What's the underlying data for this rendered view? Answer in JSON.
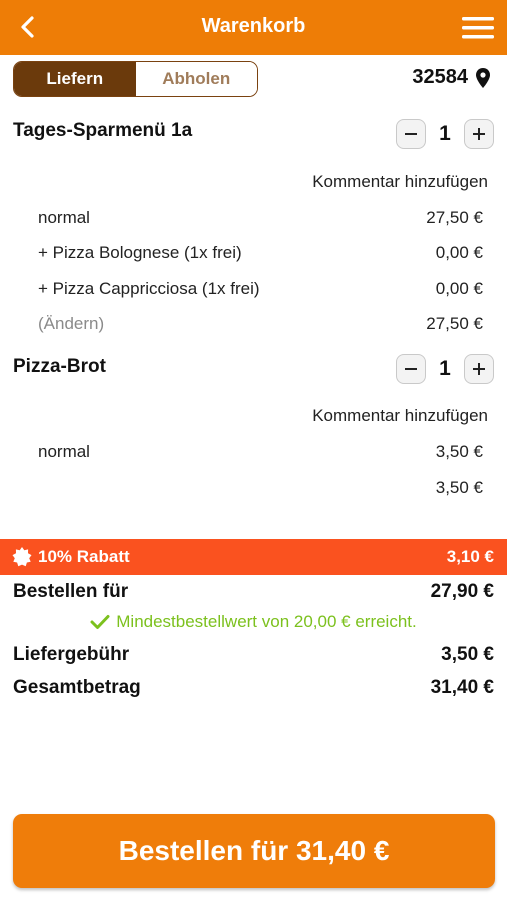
{
  "header": {
    "title": "Warenkorb"
  },
  "mode": {
    "deliver_label": "Liefern",
    "pickup_label": "Abholen",
    "selected": "deliver"
  },
  "location": {
    "zip": "32584"
  },
  "cart": {
    "items": [
      {
        "name": "Tages-Sparmenü 1a",
        "quantity": "1",
        "comment_label": "Kommentar hinzufügen",
        "lines": [
          {
            "label": "normal",
            "price": "27,50 €"
          },
          {
            "label": "+ Pizza Bolognese (1x frei)",
            "price": "0,00 €"
          },
          {
            "label": "+ Pizza Cappricciosa (1x frei)",
            "price": "0,00 €"
          },
          {
            "label": "(Ändern)",
            "price": "27,50 €"
          }
        ]
      },
      {
        "name": "Pizza-Brot",
        "quantity": "1",
        "comment_label": "Kommentar hinzufügen",
        "lines": [
          {
            "label": "normal",
            "price": "3,50 €"
          }
        ],
        "total": "3,50 €"
      }
    ]
  },
  "discount": {
    "label": "10% Rabatt",
    "amount": "3,10 €"
  },
  "summary": {
    "order_for_label": "Bestellen für",
    "order_for_value": "27,90 €",
    "min_order_note": "Mindestbestellwert von 20,00 € erreicht.",
    "delivery_fee_label": "Liefergebühr",
    "delivery_fee_value": "3,50 €",
    "total_label": "Gesamtbetrag",
    "total_value": "31,40 €"
  },
  "order_button": {
    "label": "Bestellen für 31,40 €"
  },
  "colors": {
    "brand_orange": "#ee7d06",
    "toggle_active": "#6b3a0c",
    "discount_red": "#fa521f",
    "success_green": "#7cc11e"
  }
}
